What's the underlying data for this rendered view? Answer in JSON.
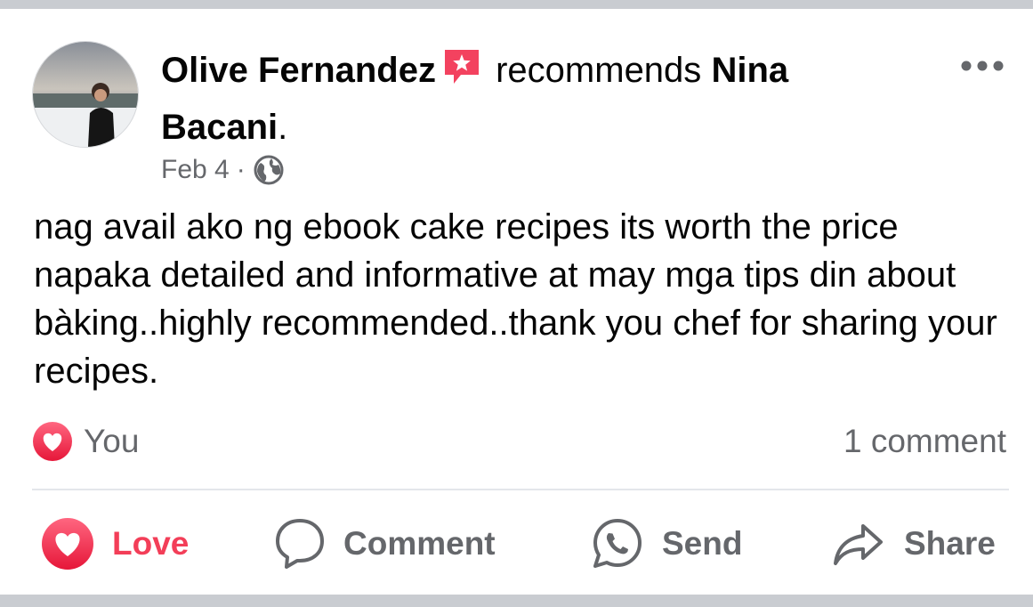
{
  "post": {
    "author": "Olive Fernandez",
    "verb": "recommends",
    "target": "Nina Bacani",
    "target_suffix": ".",
    "date": "Feb 4",
    "separator": "·",
    "privacy_icon": "globe-icon",
    "body": "nag avail ako ng ebook cake recipes its worth the price napaka detailed and informative at may mga tips din about bàking..highly recommended..thank you chef for sharing your recipes."
  },
  "reactions": {
    "icon": "love-reaction-icon",
    "label": "You",
    "comment_count": "1 comment"
  },
  "actions": {
    "love_label": "Love",
    "comment_label": "Comment",
    "send_label": "Send",
    "share_label": "Share"
  },
  "colors": {
    "love": "#f33e58",
    "recommend_badge": "#f3425f",
    "muted_text": "#65676b",
    "divider": "#e4e6eb",
    "band": "#c9ccd1"
  }
}
